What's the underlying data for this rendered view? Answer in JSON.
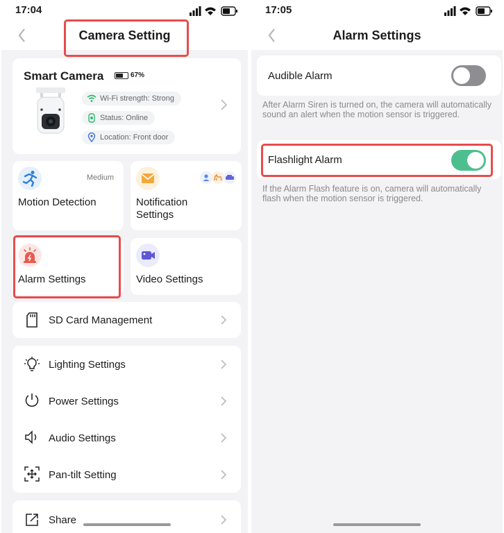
{
  "left": {
    "status": {
      "time": "17:04"
    },
    "nav": {
      "title": "Camera Setting"
    },
    "camera": {
      "name": "Smart Camera",
      "battery": "67%",
      "battery_level": 0.67,
      "wifi": "Wi-Fi strength: Strong",
      "status": "Status: Online",
      "location": "Location: Front door"
    },
    "tiles": {
      "motion": {
        "label": "Motion Detection",
        "level": "Medium"
      },
      "notification": {
        "label": "Notification Settings"
      },
      "alarm": {
        "label": "Alarm Settings"
      },
      "video": {
        "label": "Video Settings"
      }
    },
    "rows": {
      "sd": "SD Card Management",
      "lighting": "Lighting Settings",
      "power": "Power Settings",
      "audio": "Audio Settings",
      "pantilt": "Pan-tilt Setting",
      "share": "Share"
    }
  },
  "right": {
    "status": {
      "time": "17:05"
    },
    "nav": {
      "title": "Alarm Settings"
    },
    "audible": {
      "label": "Audible Alarm",
      "enabled": false,
      "description": "After Alarm Siren is turned on, the camera will automatically sound an alert when the motion sensor is triggered."
    },
    "flashlight": {
      "label": "Flashlight Alarm",
      "enabled": true,
      "description": "If the Alarm Flash feature is on, camera will automatically flash when the motion sensor is triggered."
    }
  },
  "colors": {
    "highlight": "#e84b4b",
    "toggle_on": "#4dbf8f",
    "toggle_off": "#8e8e92",
    "wifi": "#2db86b"
  }
}
